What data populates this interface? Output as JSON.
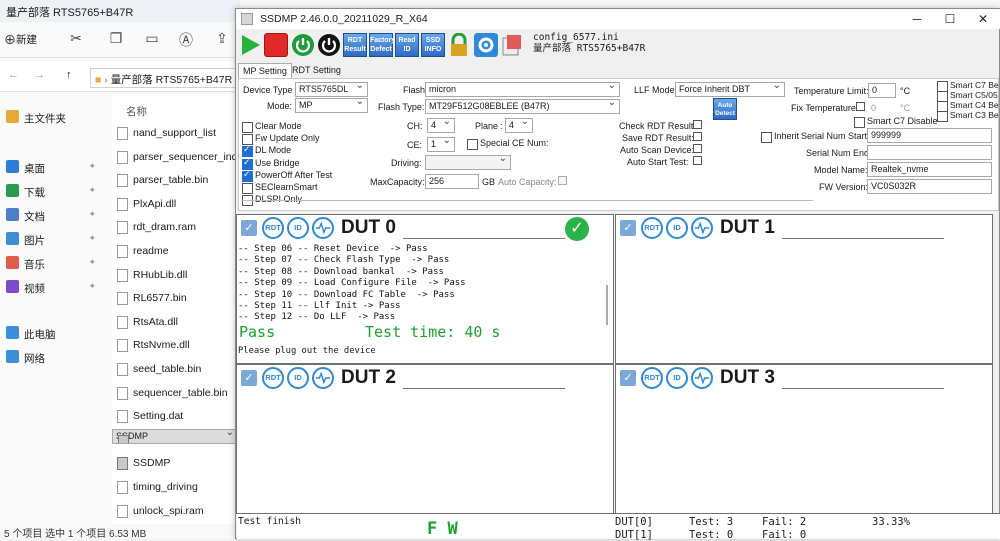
{
  "explorer": {
    "title": "量产部落 RTS5765+B47R",
    "toolbar": {
      "new_label": "新建"
    },
    "breadcrumb": "量产部落 RTS5765+B47R",
    "column_header": "名称",
    "nav": [
      {
        "label": "主文件夹",
        "icon": "home-icon",
        "color": "#e8a93a"
      },
      {
        "label": "桌面",
        "icon": "desktop-icon",
        "color": "#2e7dd7"
      },
      {
        "label": "下载",
        "icon": "download-icon",
        "color": "#2b9b4f"
      },
      {
        "label": "文档",
        "icon": "document-icon",
        "color": "#4d7fc9"
      },
      {
        "label": "图片",
        "icon": "picture-icon",
        "color": "#3a8fd6"
      },
      {
        "label": "音乐",
        "icon": "music-icon",
        "color": "#e15a4a"
      },
      {
        "label": "视频",
        "icon": "video-icon",
        "color": "#7b4bc9"
      },
      {
        "label": "此电脑",
        "icon": "computer-icon",
        "color": "#3d8fd8"
      },
      {
        "label": "网络",
        "icon": "network-icon",
        "color": "#3d8fd8"
      }
    ],
    "files": [
      "nand_support_list",
      "parser_sequencer_inde",
      "parser_table.bin",
      "PlxApi.dll",
      "rdt_dram.ram",
      "readme",
      "RHubLib.dll",
      "RL6577.bin",
      "RtsAta.dll",
      "RtsNvme.dll",
      "seed_table.bin",
      "sequencer_table.bin",
      "Setting.dat",
      "SSDMP",
      "SSDMP",
      "timing_driving",
      "unlock_spi.ram"
    ],
    "status": "5 个项目   选中 1 个项目  6.53 MB"
  },
  "app": {
    "title": "SSDMP 2.46.0.0_20211029_R_X64",
    "config_line1": "config_6577.ini",
    "config_line2": "量产部落 RTS5765+B47R",
    "toolbar": {
      "rdt_result": "RDT Result",
      "factory_defect": "Factory Defect",
      "read_id": "Read ID",
      "ssd_info": "SSD INFO"
    },
    "tabs": [
      "MP Setting",
      "RDT Setting"
    ],
    "settings": {
      "device_type_label": "Device Type",
      "device_type": "RTS5765DL",
      "mode_label": "Mode:",
      "mode": "MP",
      "flash_label": "Flash",
      "flash": "micron",
      "flash_type_label": "Flash Type:",
      "flash_type": "MT29F512G08EBLEE (B47R)",
      "llf_mode_label": "LLF Mode:",
      "llf_mode": "Force Inherit DBT",
      "ch_label": "CH:",
      "ch": "4",
      "plane_label": "Plane :",
      "plane": "4",
      "ce_label": "CE:",
      "ce": "1",
      "special_ce_label": "Special CE Num:",
      "driving_label": "Driving:",
      "max_capacity_label": "MaxCapacity:",
      "max_capacity": "256",
      "gb": "GB",
      "auto_capacity_label": "Auto Capacity:",
      "checks_left": [
        {
          "label": "Clear Mode",
          "on": false
        },
        {
          "label": "Fw Update Only",
          "on": false
        },
        {
          "label": "DL Mode",
          "on": true
        },
        {
          "label": "Use Bridge",
          "on": true
        },
        {
          "label": "PowerOff After Test",
          "on": true
        },
        {
          "label": "SEClearnSmart",
          "on": false
        },
        {
          "label": "DLSPI Only",
          "on": false
        }
      ],
      "check_rdt_result": "Check RDT Result:",
      "save_rdt_result": "Save RDT Result:",
      "auto_scan_device": "Auto Scan Device:",
      "auto_start_test": "Auto Start Test:",
      "auto_detect": "Auto Detect",
      "temp_limit_label": "Temperature Limit:",
      "temp_limit": "0",
      "temp_unit": "°C",
      "fix_temp_label": "Fix Temperature",
      "fix_temp": "0",
      "smart_c7_disable": "Smart C7 Disable",
      "inherit_serial_label": "Inherit",
      "serial_start_label": "Serial Num Start:",
      "serial_start": "999999",
      "serial_end_label": "Serial Num End:",
      "model_name_label": "Model Name:",
      "model_name": "Realtek_nvme",
      "fw_version_label": "FW Version:",
      "fw_version": "VC0S032R",
      "smart_right": [
        "Smart C7 Be",
        "Smart C5/05",
        "Smart C4 Be",
        "Smart C3 Be"
      ]
    },
    "duts": [
      {
        "title": "DUT 0",
        "passed": true,
        "log": [
          "-- Step 06 -- Reset Device  -> Pass",
          "-- Step 07 -- Check Flash Type  -> Pass",
          "-- Step 08 -- Download bankal  -> Pass",
          "-- Step 09 -- Load Configure File  -> Pass",
          "-- Step 10 -- Download FC Table  -> Pass",
          "-- Step 11 -- Llf Init -> Pass",
          "-- Step 12 -- Do LLF  -> Pass"
        ],
        "result": "Pass",
        "test_time": "Test time: 40 s",
        "message": "Please plug out the device"
      },
      {
        "title": "DUT 1"
      },
      {
        "title": "DUT 2"
      },
      {
        "title": "DUT 3"
      }
    ],
    "dut_icons": {
      "rdt": "RDT",
      "id": "ID"
    },
    "bottom": {
      "status": "Test finish",
      "fw": "F W",
      "dut0": "DUT[0]",
      "dut1": "DUT[1]",
      "test0": "Test: 3",
      "fail0": "Fail: 2",
      "pct0": "33.33%",
      "test1": "Test: 0",
      "fail1": "Fail: 0"
    },
    "colors": {
      "pass_green": "#1aa22a",
      "accent_blue": "#2c8ad8"
    }
  }
}
